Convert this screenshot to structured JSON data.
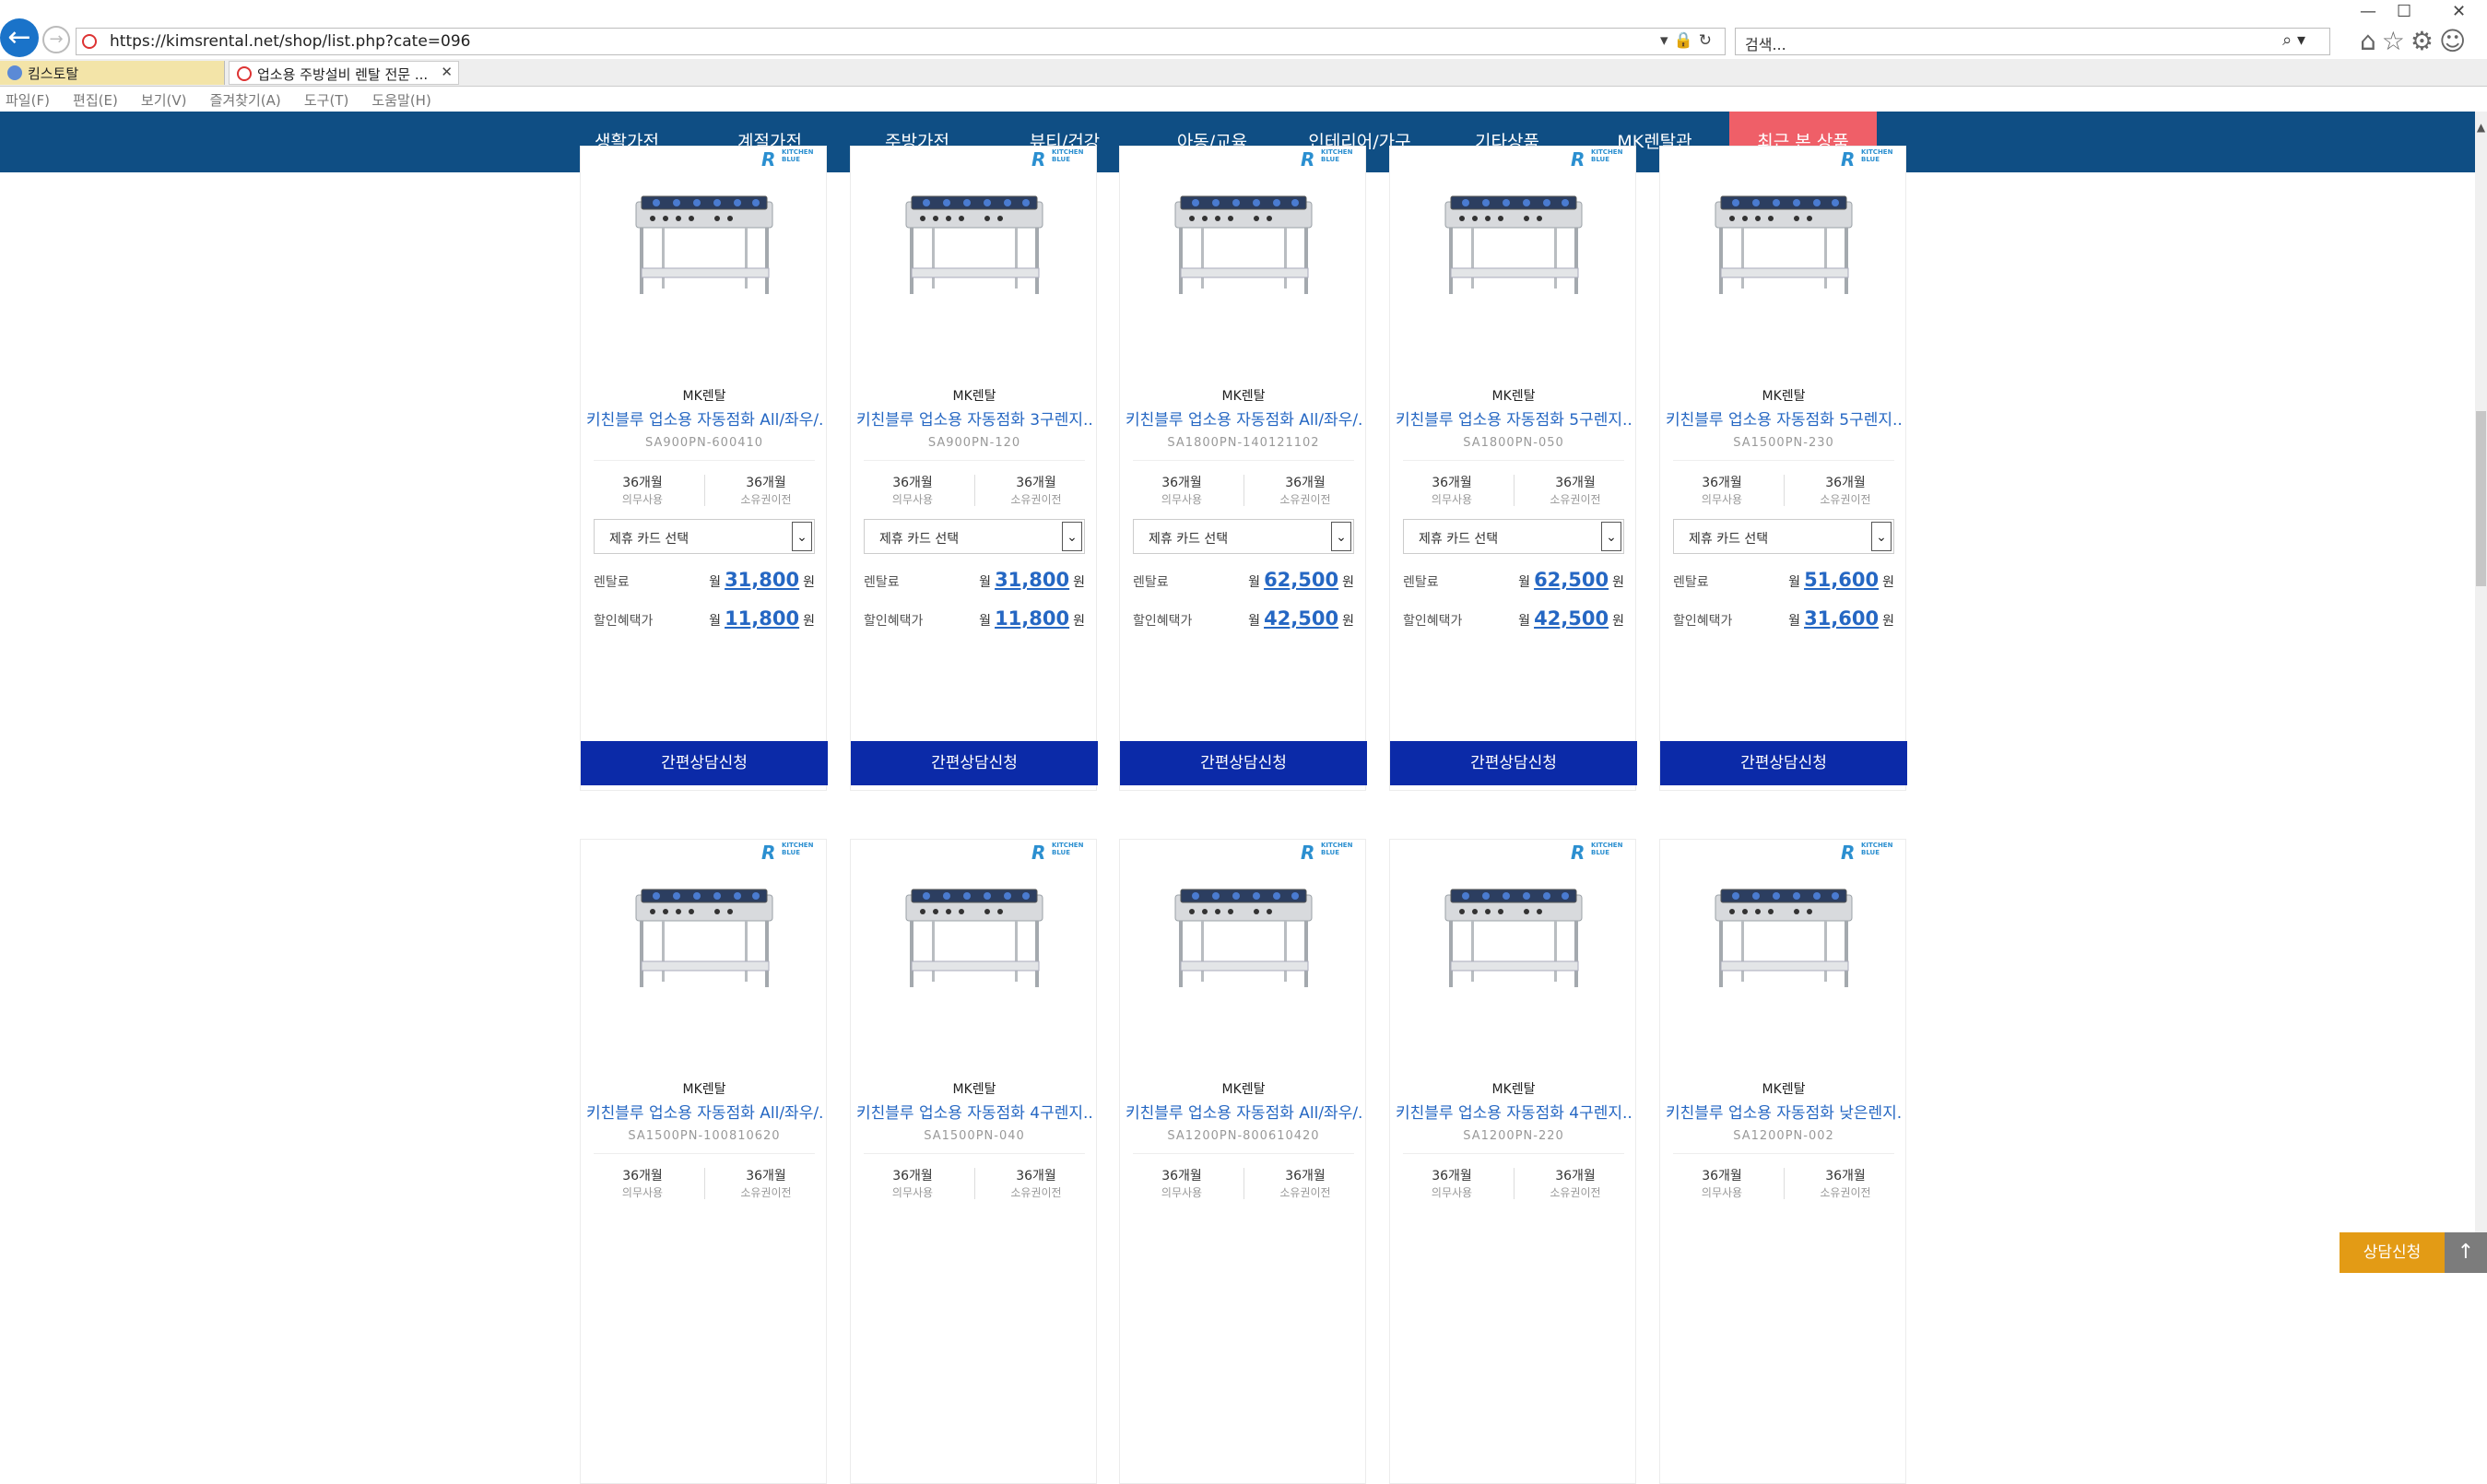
{
  "browser": {
    "url": "https://kimsrental.net/shop/list.php?cate=096",
    "search_placeholder": "검색...",
    "tabs": [
      {
        "label": "킴스토탈"
      },
      {
        "label": "업소용 주방설비 렌탈 전문 ..."
      }
    ],
    "menu": [
      "파일(F)",
      "편집(E)",
      "보기(V)",
      "즐겨찾기(A)",
      "도구(T)",
      "도움말(H)"
    ]
  },
  "site_nav": {
    "items": [
      "생활가전",
      "계절가전",
      "주방가전",
      "뷰티/건강",
      "아동/교육",
      "인테리어/가구",
      "기타상품",
      "MK렌탈관",
      "최근 본 상품"
    ]
  },
  "card_common": {
    "brand": "MK렌탈",
    "term_value": "36개월",
    "term_label1": "의무사용",
    "term_label2": "소유권이전",
    "select_label": "제휴 카드 선택",
    "price_label": "렌탈료",
    "discount_label": "할인혜택가",
    "month_prefix": "월",
    "won": "원",
    "cta_label": "간편상담신청",
    "logo_text": "KITCHEN BLUE"
  },
  "products": [
    {
      "name": "키친블루 업소용 자동점화 All/좌우/...",
      "code": "SA900PN-600410",
      "price": "31,800",
      "discount": "11,800"
    },
    {
      "name": "키친블루 업소용 자동점화 3구렌지...",
      "code": "SA900PN-120",
      "price": "31,800",
      "discount": "11,800"
    },
    {
      "name": "키친블루 업소용 자동점화 All/좌우/...",
      "code": "SA1800PN-140121102",
      "price": "62,500",
      "discount": "42,500"
    },
    {
      "name": "키친블루 업소용 자동점화 5구렌지...",
      "code": "SA1800PN-050",
      "price": "62,500",
      "discount": "42,500"
    },
    {
      "name": "키친블루 업소용 자동점화 5구렌지...",
      "code": "SA1500PN-230",
      "price": "51,600",
      "discount": "31,600"
    },
    {
      "name": "키친블루 업소용 자동점화 All/좌우/...",
      "code": "SA1500PN-100810620",
      "price": "",
      "discount": ""
    },
    {
      "name": "키친블루 업소용 자동점화 4구렌지...",
      "code": "SA1500PN-040",
      "price": "",
      "discount": ""
    },
    {
      "name": "키친블루 업소용 자동점화 All/좌우/...",
      "code": "SA1200PN-800610420",
      "price": "",
      "discount": ""
    },
    {
      "name": "키친블루 업소용 자동점화 4구렌지...",
      "code": "SA1200PN-220",
      "price": "",
      "discount": ""
    },
    {
      "name": "키친블루 업소용 자동점화 낮은렌지...",
      "code": "SA1200PN-002",
      "price": "",
      "discount": ""
    }
  ],
  "floating": {
    "consult_label": "상담신청"
  },
  "colors": {
    "nav_bg": "#0f4e84",
    "recent_bg": "#ef5f68",
    "cta_bg": "#0b2aa8",
    "price_blue": "#2567c3",
    "consult_bg": "#e39b15"
  }
}
